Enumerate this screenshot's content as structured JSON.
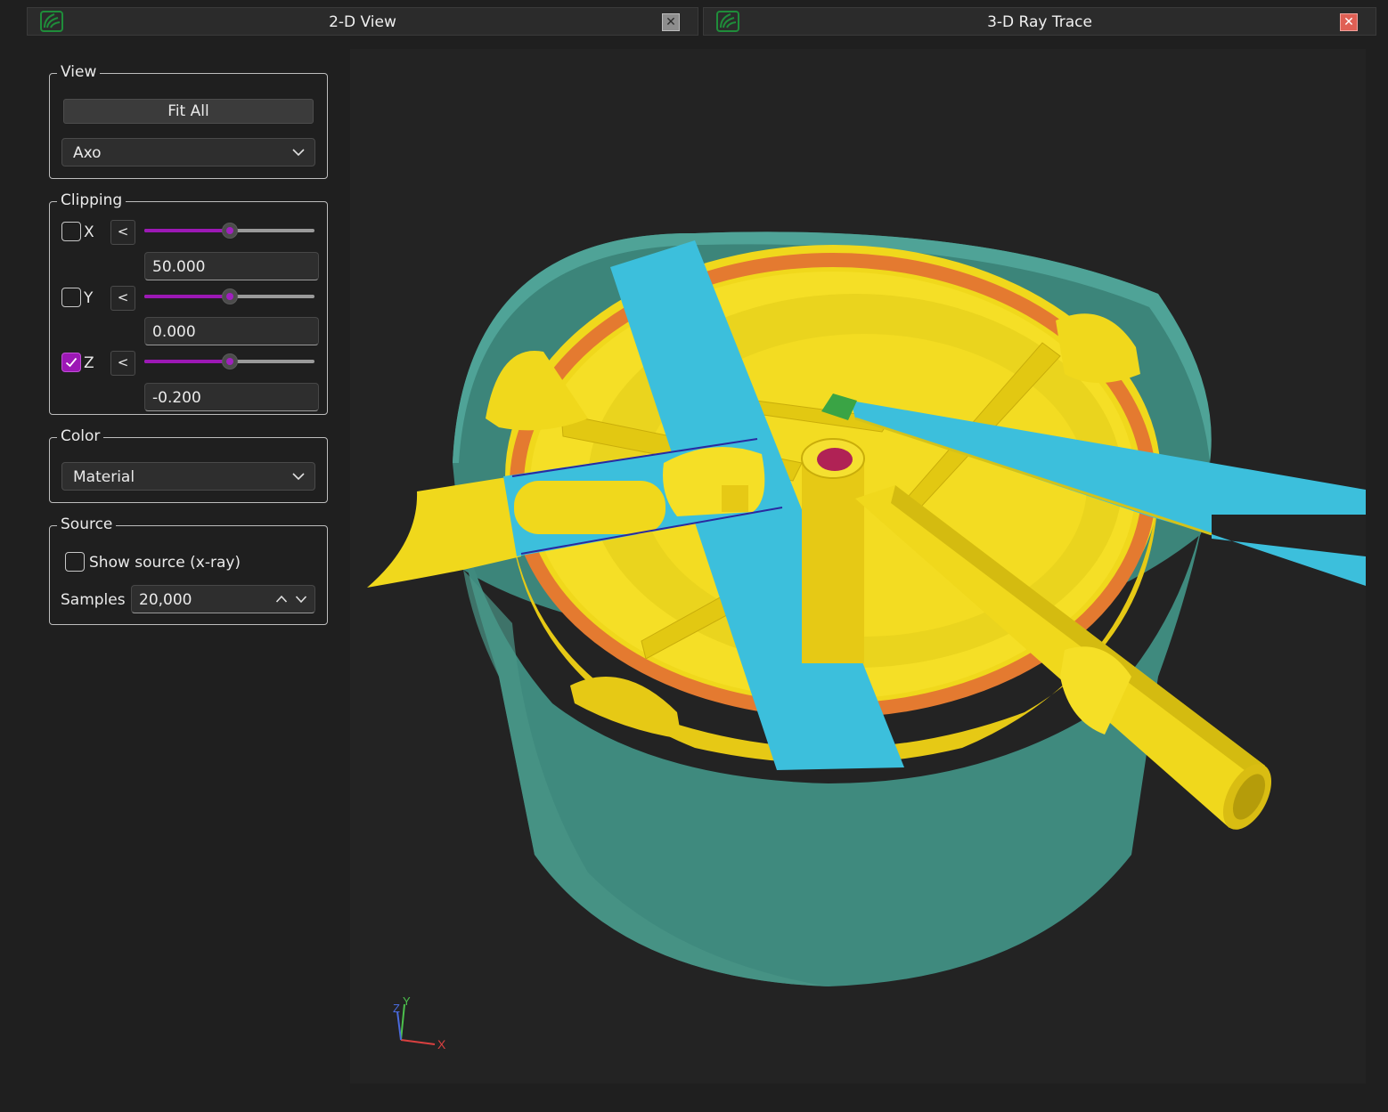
{
  "tabs": [
    {
      "title": "2-D View",
      "close": "✕"
    },
    {
      "title": "3-D Ray Trace",
      "close": "✕"
    }
  ],
  "view_group": {
    "legend": "View",
    "fit_all": "Fit All",
    "projection": "Axo"
  },
  "clipping": {
    "legend": "Clipping",
    "back_label": "<",
    "axes": [
      {
        "label": "X",
        "checked": false,
        "value": "50.000",
        "slider_fraction": 0.5
      },
      {
        "label": "Y",
        "checked": false,
        "value": "0.000",
        "slider_fraction": 0.5
      },
      {
        "label": "Z",
        "checked": true,
        "value": "-0.200",
        "slider_fraction": 0.5
      }
    ]
  },
  "color_group": {
    "legend": "Color",
    "mode": "Material"
  },
  "source_group": {
    "legend": "Source",
    "show_source_label": "Show source (x-ray)",
    "show_source_checked": false,
    "samples_label": "Samples",
    "samples_value": "20,000"
  },
  "axis_triad": {
    "x": "X",
    "y": "Y",
    "z": "Z"
  },
  "colors": {
    "accent": "#9c18b5",
    "material_yellow": "#f2dc1c",
    "material_cyan": "#3cbfdc",
    "material_orange": "#e47a30",
    "material_teal": "#3f8a7e",
    "material_green": "#3aa445",
    "material_crimson": "#b02255"
  }
}
